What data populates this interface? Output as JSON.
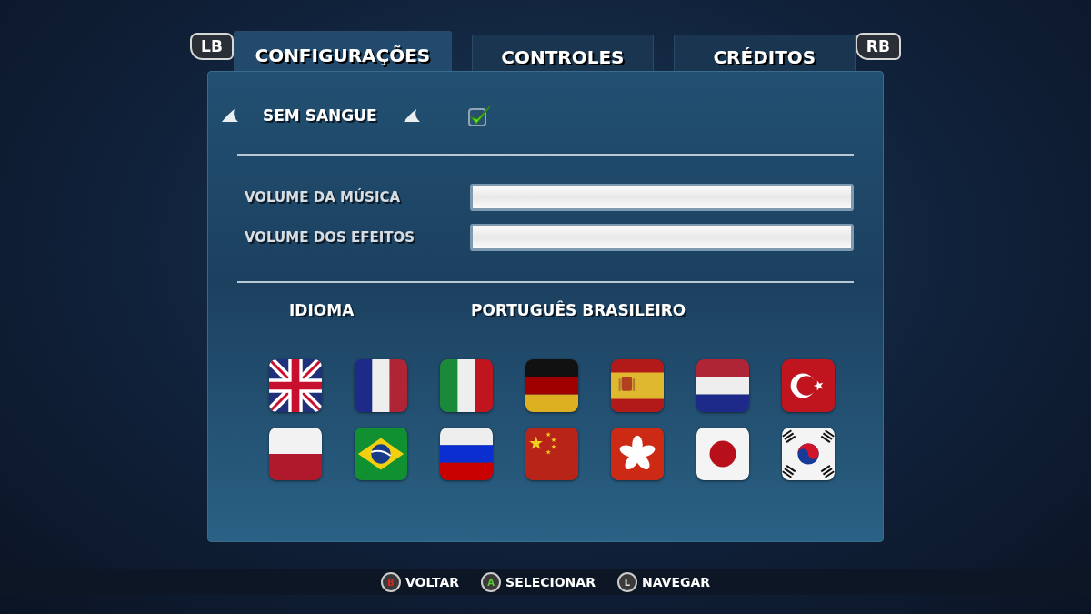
{
  "bumpers": {
    "left": "LB",
    "right": "RB"
  },
  "tabs": [
    {
      "label": "CONFIGURAÇÕES",
      "selected": true
    },
    {
      "label": "CONTROLES",
      "selected": false
    },
    {
      "label": "CRÉDITOS",
      "selected": false
    }
  ],
  "blood_option": {
    "label": "SEM SANGUE",
    "checked": true
  },
  "volumes": [
    {
      "label": "VOLUME DA MÚSICA",
      "level": 1
    },
    {
      "label": "VOLUME DOS EFEITOS",
      "level": 1
    }
  ],
  "language": {
    "label": "IDIOMA",
    "value": "PORTUGUÊS BRASILEIRO"
  },
  "flags": [
    {
      "kind": "uk"
    },
    {
      "kind": "france"
    },
    {
      "kind": "italy"
    },
    {
      "kind": "germany"
    },
    {
      "kind": "spain"
    },
    {
      "kind": "netherlands"
    },
    {
      "kind": "turkey"
    },
    {
      "kind": "poland"
    },
    {
      "kind": "brazil"
    },
    {
      "kind": "russia"
    },
    {
      "kind": "china"
    },
    {
      "kind": "hongkong"
    },
    {
      "kind": "japan"
    },
    {
      "kind": "korea"
    }
  ],
  "hints": [
    {
      "key": "B",
      "label": "VOLTAR",
      "kind": "back"
    },
    {
      "key": "A",
      "label": "SELECIONAR",
      "kind": "select"
    },
    {
      "key": "L",
      "label": "NAVEGAR",
      "kind": "navigate"
    }
  ]
}
